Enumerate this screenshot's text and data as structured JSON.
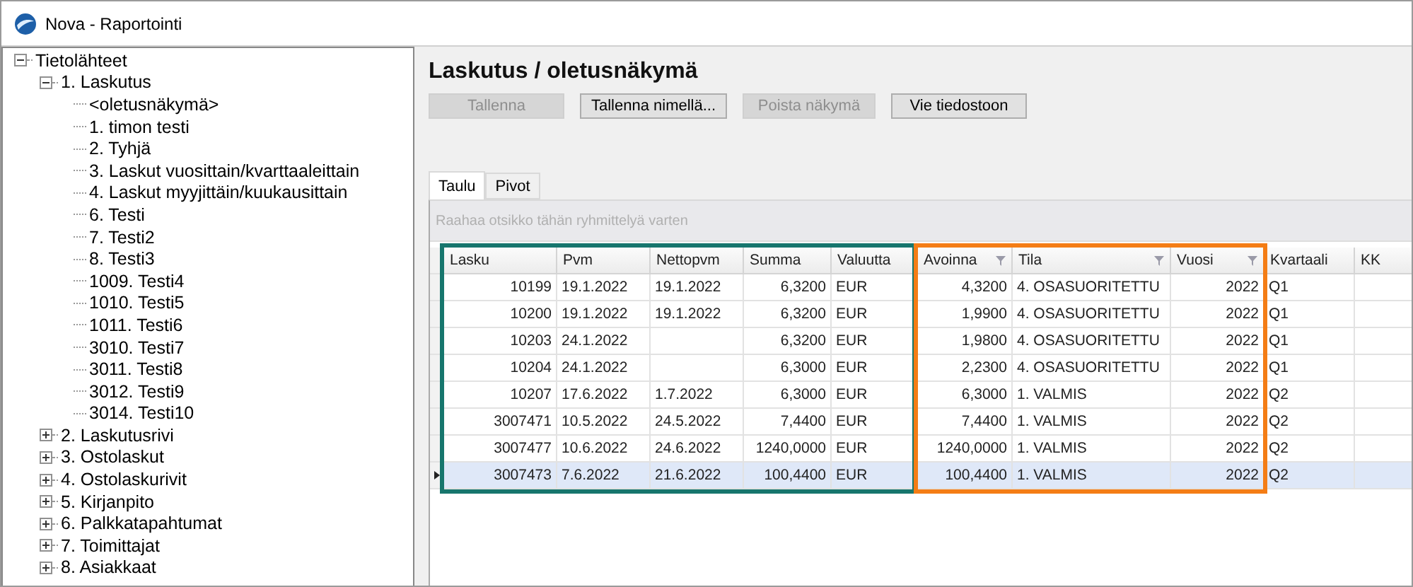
{
  "window": {
    "title": "Nova - Raportointi"
  },
  "tree": [
    {
      "label": "Tietolähteet",
      "expanded": true,
      "children": [
        {
          "label": "1. Laskutus",
          "expanded": true,
          "children": [
            {
              "label": "<oletusnäkymä>"
            },
            {
              "label": "1. timon testi"
            },
            {
              "label": "2. Tyhjä"
            },
            {
              "label": "3. Laskut vuosittain/kvarttaaleittain"
            },
            {
              "label": "4. Laskut myyjittäin/kuukausittain"
            },
            {
              "label": "6. Testi"
            },
            {
              "label": "7. Testi2"
            },
            {
              "label": "8. Testi3"
            },
            {
              "label": "1009. Testi4"
            },
            {
              "label": "1010. Testi5"
            },
            {
              "label": "1011. Testi6"
            },
            {
              "label": "3010. Testi7"
            },
            {
              "label": "3011. Testi8"
            },
            {
              "label": "3012. Testi9"
            },
            {
              "label": "3014. Testi10"
            }
          ]
        },
        {
          "label": "2. Laskutusrivi",
          "expanded": false
        },
        {
          "label": "3. Ostolaskut",
          "expanded": false
        },
        {
          "label": "4. Ostolaskurivit",
          "expanded": false
        },
        {
          "label": "5. Kirjanpito",
          "expanded": false
        },
        {
          "label": "6. Palkkatapahtumat",
          "expanded": false
        },
        {
          "label": "7. Toimittajat",
          "expanded": false
        },
        {
          "label": "8. Asiakkaat",
          "expanded": false
        }
      ]
    }
  ],
  "view": {
    "title": "Laskutus / oletusnäkymä",
    "buttons": [
      {
        "label": "Tallenna",
        "disabled": true
      },
      {
        "label": "Tallenna nimellä...",
        "disabled": false
      },
      {
        "label": "Poista näkymä",
        "disabled": true
      },
      {
        "label": "Vie tiedostoon",
        "disabled": false
      }
    ],
    "tabs": [
      {
        "label": "Taulu",
        "selected": true
      },
      {
        "label": "Pivot",
        "selected": false
      }
    ],
    "group_panel": {
      "placeholder": "Raahaa otsikko tähän ryhmittelyä varten"
    },
    "table": {
      "columns": [
        {
          "label": "Lasku",
          "color": "#17766d"
        },
        {
          "label": "Pvm",
          "color": "#17766d"
        },
        {
          "label": "Nettopvm",
          "color": "#17766d"
        },
        {
          "label": "Summa",
          "color": "#17766d"
        },
        {
          "label": "Valuutta",
          "color": "#17766d"
        },
        {
          "label": "Avoinna",
          "filtered": true,
          "color": "#f47d15"
        },
        {
          "label": "Tila",
          "filtered": true,
          "color": "#f47d15"
        },
        {
          "label": "Vuosi",
          "filtered": true,
          "color": "#f47d15"
        },
        {
          "label": "Kvartaali"
        },
        {
          "label": "KK"
        }
      ],
      "rows": [
        {
          "selected": false,
          "cells": [
            "10199",
            "19.1.2022",
            "19.1.2022",
            "6,3200",
            "EUR",
            "4,3200",
            "4. OSASUORITETTU",
            "2022",
            "Q1"
          ]
        },
        {
          "selected": false,
          "cells": [
            "10200",
            "19.1.2022",
            "19.1.2022",
            "6,3200",
            "EUR",
            "1,9900",
            "4. OSASUORITETTU",
            "2022",
            "Q1"
          ]
        },
        {
          "selected": false,
          "cells": [
            "10203",
            "24.1.2022",
            null,
            "6,3200",
            "EUR",
            "1,9800",
            "4. OSASUORITETTU",
            "2022",
            "Q1"
          ]
        },
        {
          "selected": false,
          "cells": [
            "10204",
            "24.1.2022",
            null,
            "6,3000",
            "EUR",
            "2,2300",
            "4. OSASUORITETTU",
            "2022",
            "Q1"
          ]
        },
        {
          "selected": false,
          "cells": [
            "10207",
            "17.6.2022",
            "1.7.2022",
            "6,3000",
            "EUR",
            "6,3000",
            "1. VALMIS",
            "2022",
            "Q2"
          ]
        },
        {
          "selected": false,
          "cells": [
            "3007471",
            "10.5.2022",
            "24.5.2022",
            "7,4400",
            "EUR",
            "7,4400",
            "1. VALMIS",
            "2022",
            "Q2"
          ]
        },
        {
          "selected": false,
          "cells": [
            "3007477",
            "10.6.2022",
            "24.6.2022",
            "1240,0000",
            "EUR",
            "1240,0000",
            "1. VALMIS",
            "2022",
            "Q2"
          ]
        },
        {
          "selected": true,
          "cells": [
            "3007473",
            "7.6.2022",
            "21.6.2022",
            "100,4400",
            "EUR",
            "100,4400",
            "1. VALMIS",
            "2022",
            "Q2"
          ]
        }
      ]
    }
  }
}
